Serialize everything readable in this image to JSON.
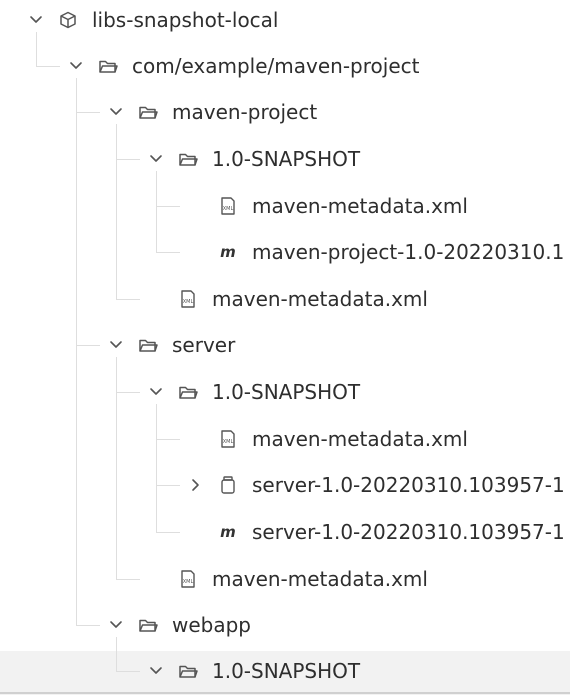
{
  "tree": {
    "rows": [
      {
        "label": "libs-snapshot-local",
        "chevron": "down",
        "icon": "repository-icon"
      },
      {
        "label": "com/example/maven-project",
        "chevron": "down",
        "icon": "folder-icon"
      },
      {
        "label": "maven-project",
        "chevron": "down",
        "icon": "folder-icon"
      },
      {
        "label": "1.0-SNAPSHOT",
        "chevron": "down",
        "icon": "folder-icon"
      },
      {
        "label": "maven-metadata.xml",
        "chevron": "none",
        "icon": "xml-file-icon"
      },
      {
        "label": "maven-project-1.0-20220310.1",
        "chevron": "none",
        "icon": "maven-pom-icon"
      },
      {
        "label": "maven-metadata.xml",
        "chevron": "none",
        "icon": "xml-file-icon"
      },
      {
        "label": "server",
        "chevron": "down",
        "icon": "folder-icon"
      },
      {
        "label": "1.0-SNAPSHOT",
        "chevron": "down",
        "icon": "folder-icon"
      },
      {
        "label": "maven-metadata.xml",
        "chevron": "none",
        "icon": "xml-file-icon"
      },
      {
        "label": "server-1.0-20220310.103957-1",
        "chevron": "right",
        "icon": "jar-file-icon"
      },
      {
        "label": "server-1.0-20220310.103957-1",
        "chevron": "none",
        "icon": "maven-pom-icon"
      },
      {
        "label": "maven-metadata.xml",
        "chevron": "none",
        "icon": "xml-file-icon"
      },
      {
        "label": "webapp",
        "chevron": "down",
        "icon": "folder-icon"
      },
      {
        "label": "1.0-SNAPSHOT",
        "chevron": "down",
        "icon": "folder-icon"
      }
    ]
  },
  "colors": {
    "text": "#2e2e2e",
    "icon": "#555555",
    "guide_line": "#dedede",
    "selected_row_bg": "#f2f2f2"
  }
}
